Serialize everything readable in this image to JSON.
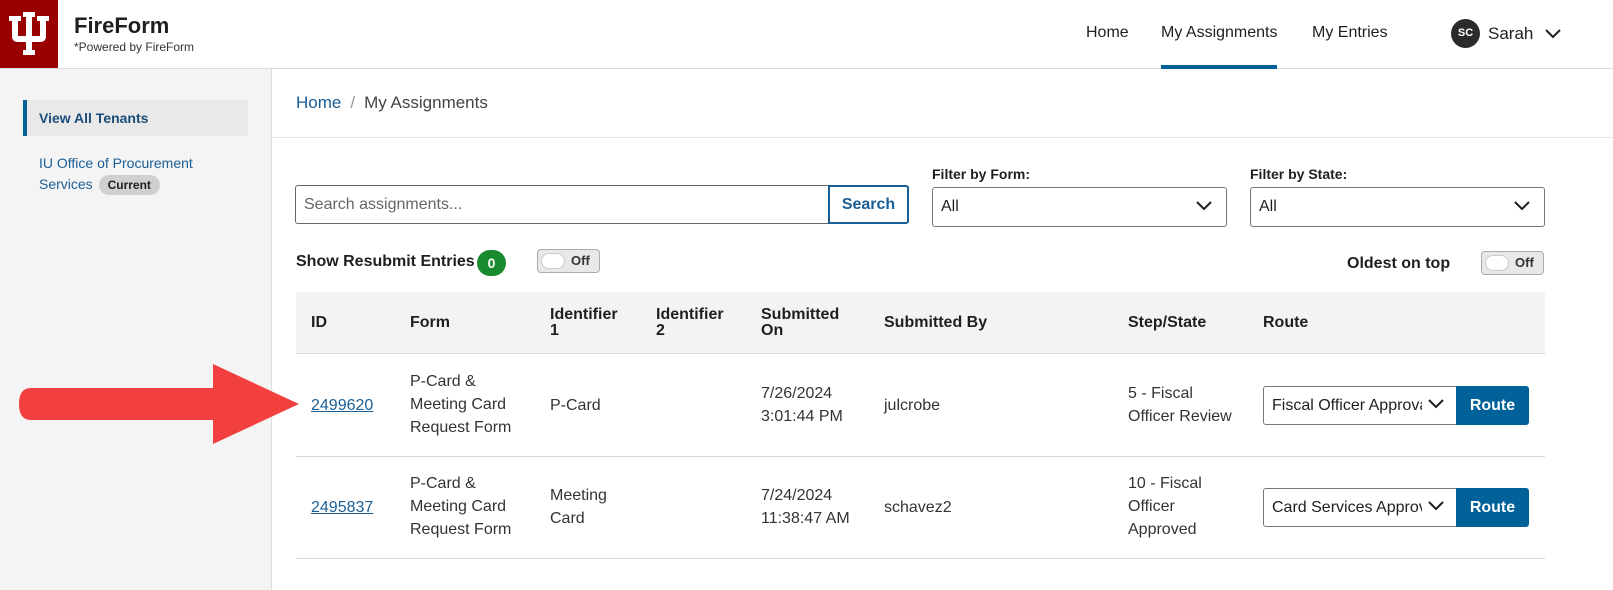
{
  "brand": {
    "title": "FireForm",
    "subtitle": "*Powered by FireForm",
    "logo_color": "#990000"
  },
  "nav": {
    "items": [
      {
        "label": "Home",
        "active": false
      },
      {
        "label": "My Assignments",
        "active": true
      },
      {
        "label": "My Entries",
        "active": false
      }
    ],
    "user": {
      "initials": "SC",
      "name": "Sarah"
    }
  },
  "sidebar": {
    "active_label": "View All Tenants",
    "tenant_link": "IU Office of Procurement Services",
    "tenant_badge": "Current"
  },
  "breadcrumb": {
    "home": "Home",
    "separator": "/",
    "current": "My Assignments"
  },
  "search": {
    "placeholder": "Search assignments...",
    "button_label": "Search"
  },
  "filters": {
    "form": {
      "label": "Filter by Form:",
      "value": "All"
    },
    "state": {
      "label": "Filter by State:",
      "value": "All"
    }
  },
  "toggles": {
    "resubmit": {
      "label": "Show Resubmit Entries",
      "count": "0",
      "state": "Off"
    },
    "oldest": {
      "label": "Oldest on top",
      "state": "Off"
    }
  },
  "table": {
    "headers": {
      "id": "ID",
      "form": "Form",
      "identifier1_a": "Identifier",
      "identifier1_b": "1",
      "identifier2_a": "Identifier",
      "identifier2_b": "2",
      "submitted_a": "Submitted",
      "submitted_b": "On",
      "submitted_by": "Submitted By",
      "step_state": "Step/State",
      "route": "Route"
    },
    "rows": [
      {
        "id": "2499620",
        "form": [
          "P-Card &",
          "Meeting Card",
          "Request Form"
        ],
        "identifier1": [
          "P-Card"
        ],
        "identifier2": "",
        "submitted_on": [
          "7/26/2024",
          "3:01:44 PM"
        ],
        "submitted_by": "julcrobe",
        "step_state": [
          "5 - Fiscal",
          "Officer Review"
        ],
        "route_value": "Fiscal Officer Approval",
        "route_button": "Route"
      },
      {
        "id": "2495837",
        "form": [
          "P-Card &",
          "Meeting Card",
          "Request Form"
        ],
        "identifier1": [
          "Meeting",
          "Card"
        ],
        "identifier2": "",
        "submitted_on": [
          "7/24/2024",
          "11:38:47 AM"
        ],
        "submitted_by": "schavez2",
        "step_state": [
          "10 - Fiscal",
          "Officer",
          "Approved"
        ],
        "route_value": "Card Services Approval",
        "route_button": "Route"
      }
    ]
  },
  "colors": {
    "accent": "#006298",
    "link": "#1a5e96",
    "count_badge": "#1a8a2e",
    "annotation_arrow": "#f23f3f"
  },
  "icons": [
    "trident-logo-icon",
    "chevron-down-icon",
    "arrow-annotation-icon"
  ]
}
